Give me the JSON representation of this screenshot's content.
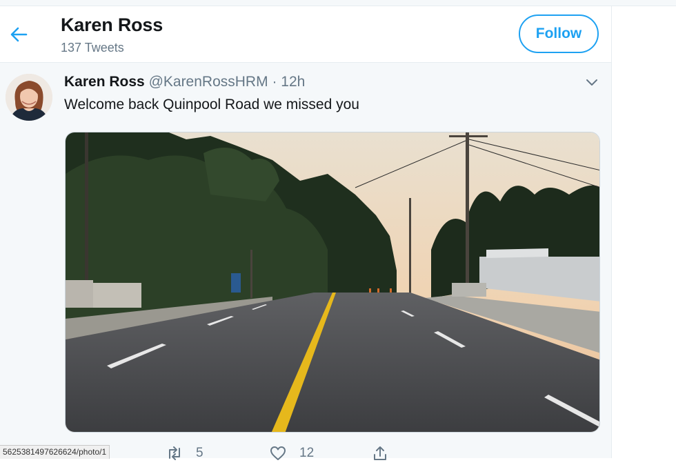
{
  "header": {
    "title": "Karen Ross",
    "tweet_count": "137 Tweets",
    "follow_label": "Follow"
  },
  "tweet": {
    "author_name": "Karen Ross",
    "handle": "@KarenRossHRM",
    "separator": "·",
    "time": "12h",
    "text": "Welcome back Quinpool Road we missed you",
    "reply_count": "",
    "retweet_count": "5",
    "like_count": "12"
  },
  "status_url": "5625381497626624/photo/1",
  "colors": {
    "accent": "#1da1f2",
    "secondary_text": "#657786",
    "tweet_bg": "#f5f8fa"
  },
  "icons": {
    "back": "arrow-left-icon",
    "menu": "chevron-down-icon",
    "retweet": "retweet-icon",
    "like": "heart-icon",
    "share": "share-icon"
  }
}
